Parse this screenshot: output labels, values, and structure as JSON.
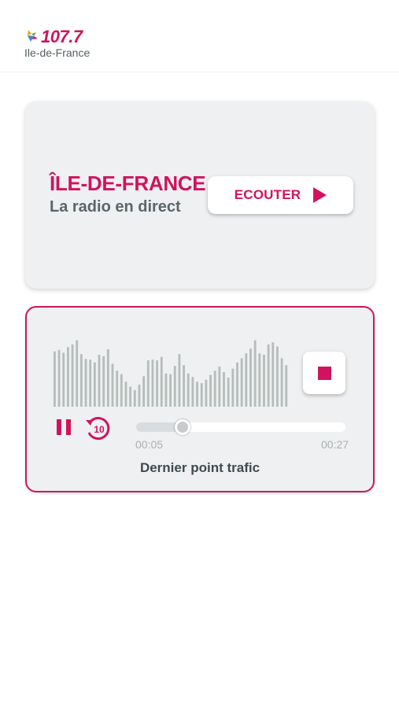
{
  "header": {
    "logo_frequency": "107.7",
    "logo_region": "Ile-de-France"
  },
  "live": {
    "title": "ÎLE-DE-FRANCE",
    "subtitle": "La radio en direct",
    "listen_label": "ECOUTER"
  },
  "player": {
    "replay_seconds": "10",
    "current_time": "00:05",
    "total_time": "00:27",
    "progress": 0.22,
    "clip_title": "Dernier point trafic",
    "waveform_levels": [
      0.8,
      0.82,
      0.78,
      0.86,
      0.9,
      0.96,
      0.76,
      0.69,
      0.68,
      0.64,
      0.75,
      0.73,
      0.83,
      0.62,
      0.52,
      0.47,
      0.36,
      0.29,
      0.24,
      0.32,
      0.44,
      0.67,
      0.68,
      0.67,
      0.72,
      0.48,
      0.47,
      0.59,
      0.76,
      0.6,
      0.48,
      0.43,
      0.36,
      0.34,
      0.39,
      0.46,
      0.52,
      0.58,
      0.5,
      0.42,
      0.55,
      0.64,
      0.7,
      0.77,
      0.84,
      0.96,
      0.77,
      0.75,
      0.9,
      0.93,
      0.87,
      0.7,
      0.6
    ]
  },
  "colors": {
    "brand": "#d0135e",
    "card_bg": "#eff0f1",
    "wave_bar": "#b5bdbb",
    "text_gray": "#5a666c"
  },
  "icons": {
    "play": "play-icon",
    "stop": "stop-icon",
    "pause": "pause-icon",
    "replay": "replay-10-icon",
    "logo_star": "star-icon"
  }
}
